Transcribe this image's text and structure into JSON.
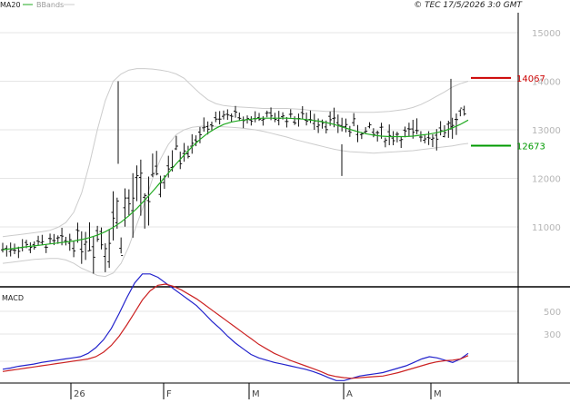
{
  "header": {
    "ma_label": "MA20",
    "bb_label": "BBands",
    "copyright": "© TEC 17/5/2026 3:0 GMT"
  },
  "colors": {
    "ma": "#22aa22",
    "bbands": "#cccccc",
    "resistance": "#cc0000",
    "support": "#009900",
    "macd": "#2222cc",
    "signal": "#cc2222",
    "price": "#111111",
    "grid": "#e6e6e6",
    "tick": "#b5b5b5"
  },
  "chart_data": [
    {
      "type": "ohlc",
      "title": "",
      "ylim": [
        10000,
        15700
      ],
      "y_ticks": [
        11000,
        12000,
        13000,
        14000,
        15000
      ],
      "y_tick_labels": [
        "11000",
        "12000",
        "13000",
        "14000",
        "15000"
      ],
      "grid": true,
      "levels": [
        {
          "name": "resistance",
          "value": 14067,
          "label": "14067"
        },
        {
          "name": "support",
          "value": 12673,
          "label": "12673"
        }
      ],
      "series": [
        {
          "name": "MA20",
          "values": [
            10530,
            10550,
            10570,
            10590,
            10610,
            10630,
            10650,
            10670,
            10690,
            10710,
            10740,
            10780,
            10830,
            10900,
            10990,
            11100,
            11230,
            11380,
            11550,
            11730,
            11920,
            12110,
            12300,
            12480,
            12650,
            12800,
            12930,
            13030,
            13110,
            13160,
            13190,
            13210,
            13230,
            13240,
            13240,
            13240,
            13240,
            13230,
            13220,
            13200,
            13180,
            13150,
            13110,
            13060,
            13010,
            12960,
            12920,
            12890,
            12870,
            12860,
            12860,
            12860,
            12870,
            12890,
            12910,
            12940,
            12980,
            13040,
            13110,
            13200
          ]
        },
        {
          "name": "BBands upper",
          "values": [
            10800,
            10820,
            10840,
            10860,
            10880,
            10900,
            10930,
            10990,
            11090,
            11300,
            11700,
            12300,
            13000,
            13600,
            14000,
            14150,
            14230,
            14260,
            14260,
            14250,
            14230,
            14200,
            14150,
            14060,
            13900,
            13750,
            13620,
            13540,
            13500,
            13480,
            13470,
            13460,
            13450,
            13440,
            13440,
            13440,
            13440,
            13430,
            13420,
            13400,
            13390,
            13380,
            13380,
            13370,
            13370,
            13360,
            13360,
            13360,
            13370,
            13380,
            13400,
            13420,
            13460,
            13520,
            13600,
            13690,
            13780,
            13880,
            13950,
            14000
          ]
        },
        {
          "name": "BBands lower",
          "values": [
            10250,
            10270,
            10290,
            10310,
            10330,
            10340,
            10350,
            10350,
            10320,
            10250,
            10150,
            10080,
            10000,
            9980,
            10050,
            10250,
            10600,
            11050,
            11500,
            12000,
            12400,
            12700,
            12900,
            13000,
            13050,
            13070,
            13080,
            13070,
            13060,
            13050,
            13040,
            13020,
            13000,
            12970,
            12930,
            12890,
            12850,
            12800,
            12760,
            12720,
            12680,
            12640,
            12600,
            12570,
            12550,
            12540,
            12530,
            12520,
            12530,
            12540,
            12550,
            12560,
            12570,
            12590,
            12610,
            12630,
            12650,
            12670,
            12700,
            12720
          ]
        }
      ]
    },
    {
      "type": "line",
      "title": "MACD",
      "ylim": [
        -100,
        1000
      ],
      "y_ticks": [
        500,
        300
      ],
      "y_tick_labels": [
        "500",
        "300"
      ],
      "x_tick_labels": [
        "26",
        "F",
        "M",
        "A",
        "M"
      ],
      "series": [
        {
          "name": "MACD",
          "values": [
            -10,
            0,
            15,
            25,
            35,
            50,
            60,
            70,
            80,
            90,
            100,
            130,
            180,
            250,
            350,
            480,
            620,
            750,
            830,
            830,
            800,
            750,
            700,
            650,
            600,
            550,
            480,
            410,
            350,
            280,
            220,
            170,
            120,
            90,
            70,
            50,
            35,
            20,
            5,
            -10,
            -30,
            -55,
            -85,
            -110,
            -110,
            -90,
            -70,
            -60,
            -50,
            -40,
            -20,
            0,
            20,
            50,
            80,
            100,
            90,
            70,
            50,
            80,
            130
          ]
        },
        {
          "name": "Signal",
          "values": [
            -30,
            -20,
            -10,
            0,
            10,
            20,
            30,
            40,
            50,
            60,
            70,
            80,
            100,
            140,
            200,
            280,
            380,
            490,
            600,
            680,
            730,
            740,
            720,
            690,
            650,
            610,
            560,
            510,
            460,
            410,
            360,
            310,
            260,
            210,
            170,
            130,
            100,
            70,
            45,
            20,
            -5,
            -30,
            -60,
            -75,
            -85,
            -90,
            -85,
            -80,
            -75,
            -70,
            -55,
            -40,
            -20,
            0,
            20,
            40,
            55,
            65,
            70,
            80,
            110
          ]
        }
      ]
    }
  ]
}
